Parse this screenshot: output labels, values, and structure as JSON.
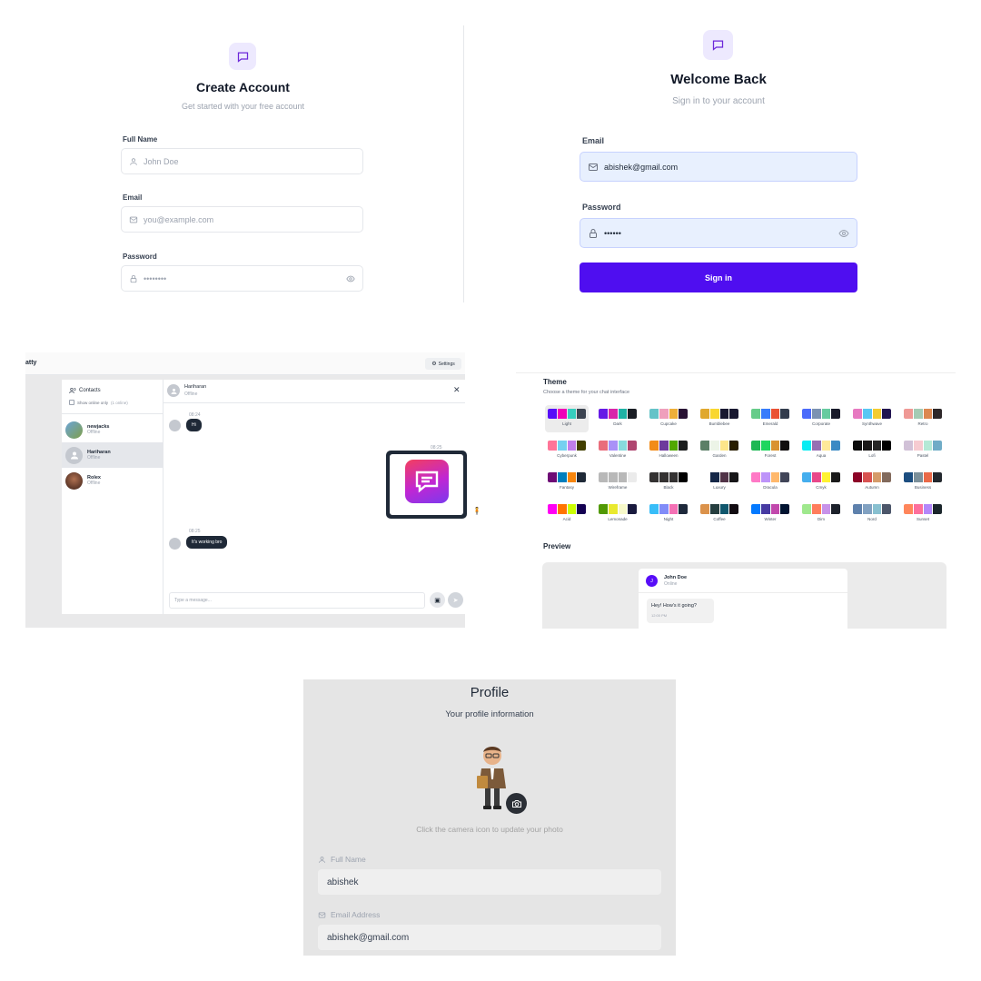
{
  "create_account": {
    "title": "Create Account",
    "subtitle": "Get started with your free account",
    "full_name_label": "Full Name",
    "full_name_placeholder": "John Doe",
    "email_label": "Email",
    "email_placeholder": "you@example.com",
    "password_label": "Password",
    "password_value": "••••••••"
  },
  "login": {
    "title": "Welcome Back",
    "subtitle": "Sign in to your account",
    "email_label": "Email",
    "email_value": "abishek@gmail.com",
    "password_label": "Password",
    "password_value": "••••••",
    "sign_in_label": "Sign in",
    "accent_color": "#4f0ef0"
  },
  "chat": {
    "app_name": "atty",
    "settings_label": "Settings",
    "contacts_label": "Contacts",
    "show_online_label": "Show online only",
    "online_count": "(1 online)",
    "contacts": [
      {
        "name": "newjacks",
        "status": "Offline"
      },
      {
        "name": "Hariharan",
        "status": "Offline"
      },
      {
        "name": "Rolex",
        "status": "Offline"
      }
    ],
    "header_name": "Hariharan",
    "header_status": "Offline",
    "messages": [
      {
        "time": "08:24",
        "text": "Hi"
      },
      {
        "time": "08:25",
        "text": ""
      },
      {
        "time": "08:25",
        "text": "It's working bro"
      }
    ],
    "input_placeholder": "Type a message..."
  },
  "theme": {
    "title": "Theme",
    "subtitle": "Choose a theme for your chat interface",
    "preview_label": "Preview",
    "themes": [
      {
        "name": "Light",
        "colors": [
          "#570df8",
          "#f000b8",
          "#37cdbe",
          "#3d4451"
        ],
        "selected": true
      },
      {
        "name": "Dark",
        "colors": [
          "#661ae6",
          "#d926aa",
          "#1fb2a5",
          "#191d24"
        ]
      },
      {
        "name": "Cupcake",
        "colors": [
          "#65c3c8",
          "#ef9fbc",
          "#eeaf3a",
          "#291334"
        ]
      },
      {
        "name": "Bumblebee",
        "colors": [
          "#e0a82e",
          "#f9d72f",
          "#181830",
          "#181830"
        ]
      },
      {
        "name": "Emerald",
        "colors": [
          "#66cc8a",
          "#377cfb",
          "#ea5234",
          "#333c4d"
        ]
      },
      {
        "name": "Corporate",
        "colors": [
          "#4b6bfb",
          "#7b92b2",
          "#67cba0",
          "#181a2a"
        ]
      },
      {
        "name": "Synthwave",
        "colors": [
          "#e779c1",
          "#58c7f3",
          "#f3cc30",
          "#221551"
        ]
      },
      {
        "name": "Retro",
        "colors": [
          "#ef9995",
          "#a4cbb4",
          "#dc8850",
          "#2e282a"
        ]
      },
      {
        "name": "Cyberpunk",
        "colors": [
          "#ff7598",
          "#75d1f0",
          "#c07eec",
          "#423f00"
        ]
      },
      {
        "name": "Valentine",
        "colors": [
          "#e96d7b",
          "#a991f7",
          "#88dbdd",
          "#af4670"
        ]
      },
      {
        "name": "Halloween",
        "colors": [
          "#f28c18",
          "#6d3a9c",
          "#51a800",
          "#1b1d1d"
        ]
      },
      {
        "name": "Garden",
        "colors": [
          "#5c7f67",
          "#ecf4e7",
          "#fde68a",
          "#291e00"
        ]
      },
      {
        "name": "Forest",
        "colors": [
          "#1eb854",
          "#1fd65f",
          "#d99330",
          "#110e0e"
        ]
      },
      {
        "name": "Aqua",
        "colors": [
          "#09ecf3",
          "#966fb3",
          "#ffe999",
          "#3b8ac4"
        ]
      },
      {
        "name": "Lofi",
        "colors": [
          "#0d0d0d",
          "#1a1919",
          "#262626",
          "#000000"
        ]
      },
      {
        "name": "Pastel",
        "colors": [
          "#d1c1d7",
          "#f6cbd1",
          "#b4e9d6",
          "#70acc7"
        ]
      },
      {
        "name": "Fantasy",
        "colors": [
          "#6e0b75",
          "#007ebd",
          "#f8860d",
          "#1f2937"
        ]
      },
      {
        "name": "Wireframe",
        "colors": [
          "#b8b8b8",
          "#b8b8b8",
          "#b8b8b8",
          "#ebebeb"
        ]
      },
      {
        "name": "Black",
        "colors": [
          "#343232",
          "#343232",
          "#343232",
          "#000000"
        ]
      },
      {
        "name": "Luxury",
        "colors": [
          "#ffffff",
          "#152747",
          "#513448",
          "#171618"
        ]
      },
      {
        "name": "Dracula",
        "colors": [
          "#ff79c6",
          "#bd93f9",
          "#ffb86c",
          "#414558"
        ]
      },
      {
        "name": "Cmyk",
        "colors": [
          "#45aeee",
          "#e8488a",
          "#fff232",
          "#1a1a1a"
        ]
      },
      {
        "name": "Autumn",
        "colors": [
          "#8c0327",
          "#d85251",
          "#d59b6a",
          "#826a5c"
        ]
      },
      {
        "name": "Business",
        "colors": [
          "#1c4e80",
          "#7c909a",
          "#ea6947",
          "#23282e"
        ]
      },
      {
        "name": "Acid",
        "colors": [
          "#ff00f4",
          "#ff7400",
          "#cbfd03",
          "#140152"
        ]
      },
      {
        "name": "Lemonade",
        "colors": [
          "#519903",
          "#e9e92e",
          "#f7f9ca",
          "#191a3e"
        ]
      },
      {
        "name": "Night",
        "colors": [
          "#38bdf8",
          "#818cf8",
          "#f471b5",
          "#1e293b"
        ]
      },
      {
        "name": "Coffee",
        "colors": [
          "#db924b",
          "#263e3f",
          "#10576d",
          "#120c12"
        ]
      },
      {
        "name": "Winter",
        "colors": [
          "#047aff",
          "#463aa2",
          "#c148ac",
          "#021431"
        ]
      },
      {
        "name": "Dim",
        "colors": [
          "#9fe88d",
          "#ff7d5c",
          "#c792e9",
          "#1c212b"
        ]
      },
      {
        "name": "Nord",
        "colors": [
          "#5e81ac",
          "#81a1c1",
          "#88c0d0",
          "#4c566a"
        ]
      },
      {
        "name": "Sunset",
        "colors": [
          "#ff865b",
          "#fd6f9c",
          "#b387fa",
          "#1b262c"
        ]
      }
    ],
    "preview": {
      "avatar_letter": "J",
      "name": "John Doe",
      "status": "Online",
      "message": "Hey! How's it going?",
      "time": "12:00 PM"
    }
  },
  "profile": {
    "title": "Profile",
    "subtitle": "Your profile information",
    "camera_hint": "Click the camera icon to update your photo",
    "full_name_label": "Full Name",
    "full_name_value": "abishek",
    "email_label": "Email Address",
    "email_value": "abishek@gmail.com"
  }
}
